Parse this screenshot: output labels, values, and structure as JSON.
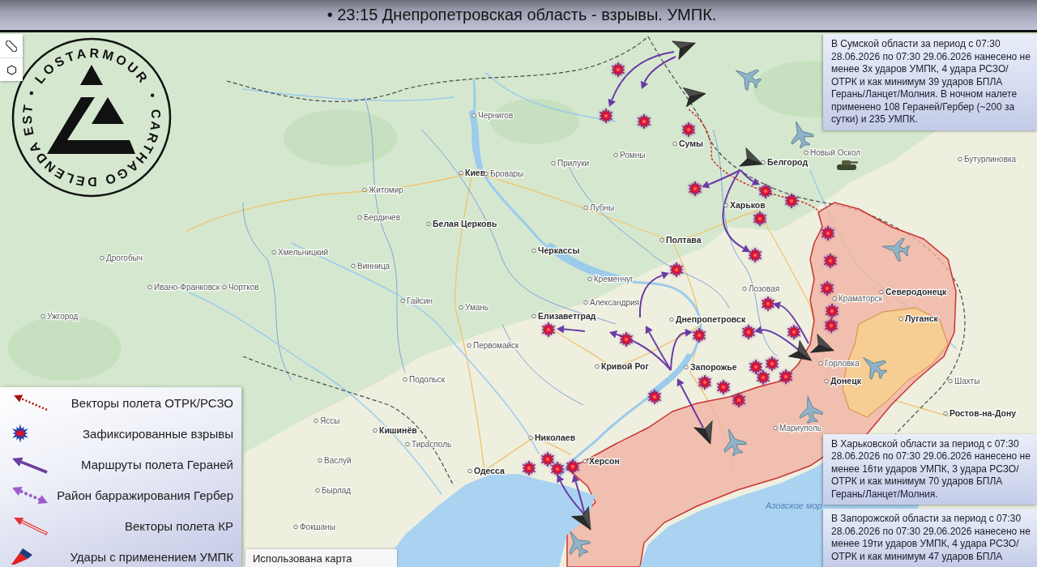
{
  "title": "• 23:15 Днепропетровская область - взрывы. УМПК.",
  "logo": {
    "brand": "LOSTARMOUR",
    "motto": "CARTHAGO DELENDA EST"
  },
  "map": {
    "cities": [
      {
        "name": "Чернигов",
        "kind": "minor"
      },
      {
        "name": "Сумы",
        "kind": "major"
      },
      {
        "name": "Прилуки",
        "kind": "minor"
      },
      {
        "name": "Ромны",
        "kind": "minor"
      },
      {
        "name": "Белгород",
        "kind": "major"
      },
      {
        "name": "Новый Оскол",
        "kind": "minor"
      },
      {
        "name": "Бутурлиновка",
        "kind": "minor"
      },
      {
        "name": "Киев",
        "kind": "major"
      },
      {
        "name": "Бровары",
        "kind": "minor"
      },
      {
        "name": "Житомир",
        "kind": "minor"
      },
      {
        "name": "Лубны",
        "kind": "minor"
      },
      {
        "name": "Харьков",
        "kind": "major"
      },
      {
        "name": "Бердичев",
        "kind": "minor"
      },
      {
        "name": "Белая Церковь",
        "kind": "major"
      },
      {
        "name": "Полтава",
        "kind": "major"
      },
      {
        "name": "Дрогобыч",
        "kind": "minor"
      },
      {
        "name": "Хмельницкий",
        "kind": "minor"
      },
      {
        "name": "Черкассы",
        "kind": "major"
      },
      {
        "name": "Винница",
        "kind": "minor"
      },
      {
        "name": "Кременчуг",
        "kind": "minor"
      },
      {
        "name": "Ивано-Франковск",
        "kind": "minor"
      },
      {
        "name": "Чортков",
        "kind": "minor"
      },
      {
        "name": "Лозовая",
        "kind": "minor"
      },
      {
        "name": "Гайсин",
        "kind": "minor"
      },
      {
        "name": "Умань",
        "kind": "minor"
      },
      {
        "name": "Александрия",
        "kind": "minor"
      },
      {
        "name": "Краматорск",
        "kind": "minor"
      },
      {
        "name": "Северодонецк",
        "kind": "major"
      },
      {
        "name": "Ужгород",
        "kind": "minor"
      },
      {
        "name": "Елизаветград",
        "kind": "major"
      },
      {
        "name": "Днепропетровск",
        "kind": "major"
      },
      {
        "name": "Луганск",
        "kind": "major"
      },
      {
        "name": "Первомайск",
        "kind": "minor"
      },
      {
        "name": "Кривой Рог",
        "kind": "major"
      },
      {
        "name": "Запорожье",
        "kind": "major"
      },
      {
        "name": "Горловка",
        "kind": "minor"
      },
      {
        "name": "Подольск",
        "kind": "minor"
      },
      {
        "name": "Донецк",
        "kind": "major"
      },
      {
        "name": "Шахты",
        "kind": "minor"
      },
      {
        "name": "Ростов-на-Дону",
        "kind": "major"
      },
      {
        "name": "Яссы",
        "kind": "minor"
      },
      {
        "name": "Кишинёв",
        "kind": "major"
      },
      {
        "name": "Мариуполь",
        "kind": "minor"
      },
      {
        "name": "Тирасполь",
        "kind": "minor"
      },
      {
        "name": "Николаев",
        "kind": "major"
      },
      {
        "name": "Васлуй",
        "kind": "minor"
      },
      {
        "name": "Херсон",
        "kind": "major"
      },
      {
        "name": "Одесса",
        "kind": "major"
      },
      {
        "name": "Бырлад",
        "kind": "minor"
      },
      {
        "name": "Фокшаны",
        "kind": "minor"
      }
    ],
    "sea_label": "Азовское мор"
  },
  "legend": [
    {
      "kind": "otrk_vector",
      "label": "Векторы полета ОТРК/РСЗО"
    },
    {
      "kind": "explosion",
      "label": "Зафиксированные взрывы"
    },
    {
      "kind": "geran_route",
      "label": "Маршруты полета Гераней"
    },
    {
      "kind": "gerber_area",
      "label": "Район барражирования Гербер"
    },
    {
      "kind": "cruise_vector",
      "label": "Векторы полета КР"
    },
    {
      "kind": "umpk_strike",
      "label": "Удары с применением УМПК"
    }
  ],
  "map_credit": "Использована карта",
  "reports": [
    "В Сумской области за период с 07:30 28.06.2026 по 07:30 29.06.2026 нанесено не менее 3х ударов УМПК, 4 удара РСЗО/ОТРК и как минимум 39 ударов БПЛА Герань/Ланцет/Молния. В ночном налете применено 108 Гераней/Гербер (~200 за сутки) и 235 УМПК.",
    "В Харьковской области за период с 07:30 28.06.2026 по 07:30 29.06.2026 нанесено не менее 16ти ударов УМПК, 3 удара РСЗО/ОТРК и как минимум 70 ударов БПЛА Герань/Ланцет/Молния.",
    "В Запорожской области за период с 07:30 28.06.2026 по 07:30 29.06.2026 нанесено не менее 19ти ударов УМПК, 4 удара РСЗО/ОТРК и как минимум 47 ударов БПЛА"
  ]
}
